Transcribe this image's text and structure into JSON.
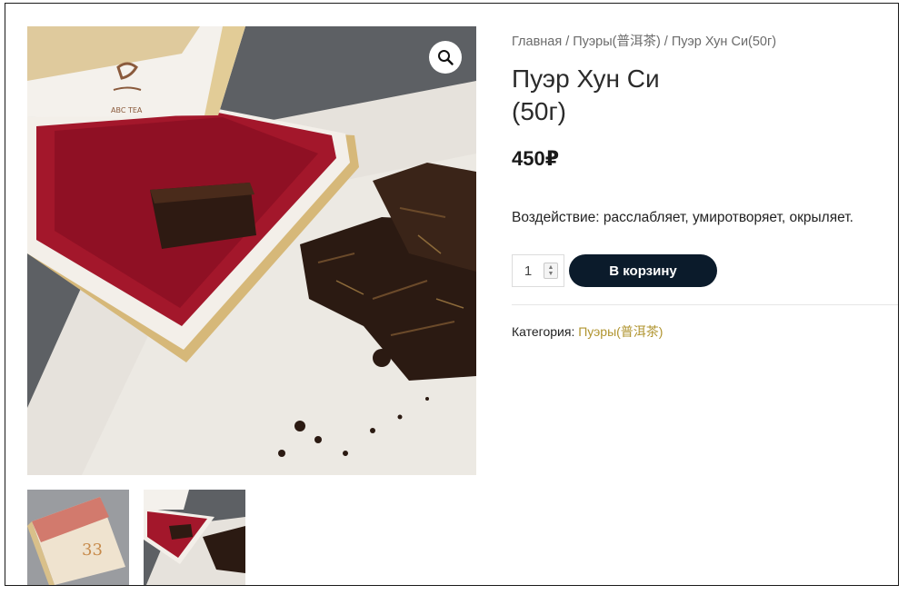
{
  "breadcrumb": {
    "home": "Главная",
    "separator": "/",
    "category": "Пуэры(普洱茶)",
    "current": "Пуэр Хун Си(50г)"
  },
  "product": {
    "title": "Пуэр Хун Си (50г)",
    "price": "450₽",
    "description": "Воздействие: расслабляет, умиротворяет, окрыляет.",
    "quantity": "1",
    "add_to_cart_label": "В корзину",
    "category_label": "Категория:",
    "category_value": "Пуэры(普洱茶)"
  },
  "gallery": {
    "zoom_icon": "magnifier-icon",
    "thumbnail_count": 2
  },
  "colors": {
    "button_bg": "#0b1b2b",
    "link_gold": "#b0942f",
    "box_red": "#a3172b"
  }
}
